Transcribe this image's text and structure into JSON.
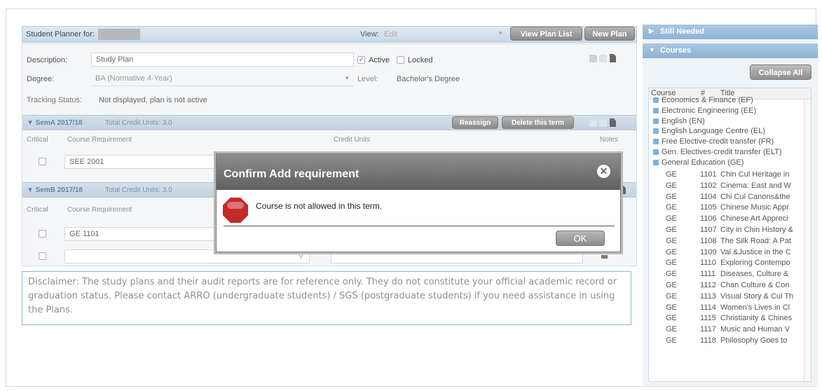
{
  "planner": {
    "title": "Student Planner for:",
    "view_label": "View:",
    "view_value": "Edit",
    "view_plan_list": "View Plan List",
    "new_plan": "New Plan"
  },
  "form": {
    "description_label": "Description:",
    "description_value": "Study Plan",
    "active_label": "Active",
    "locked_label": "Locked",
    "degree_label": "Degree:",
    "degree_value": "BA (Normative 4-Year)",
    "level_label": "Level:",
    "level_value": "Bachelor's Degree",
    "tracking_label": "Tracking Status:",
    "tracking_value": "Not displayed, plan is not active"
  },
  "terms": [
    {
      "name": "SemA 2017/18",
      "credits": "Total Credit Units: 3.0",
      "reassign": "Reassign",
      "delete": "Delete this term",
      "course": "SEE 2001"
    },
    {
      "name": "SemB 2017/18",
      "credits": "Total Credit Units: 3.0",
      "course": "GE 1101"
    }
  ],
  "columns": {
    "critical": "Critical",
    "requirement": "Course Requirement",
    "credit_units": "Credit Units",
    "notes": "Notes"
  },
  "disclaimer": "Disclaimer: The study plans and their audit reports are for reference only. They do not constitute your official academic record or graduation status. Please contact ARRO (undergraduate students) / SGS (postgraduate students) if you need assistance in using the Plans.",
  "right_panel": {
    "still_needed": "Still Needed",
    "courses": "Courses",
    "collapse_all": "Collapse All",
    "col_course": "Course",
    "col_num": "#",
    "col_title": "Title",
    "groups": [
      "Economics & Finance (EF)",
      "Electronic Engineering (EE)",
      "English (EN)",
      "English Language Centre (EL)",
      "Free Elective-credit transfer (FR)",
      "Gen. Electives-credit transfer (ELT)",
      "General Education (GE)"
    ],
    "ge_courses": [
      {
        "code": "GE",
        "num": "1101",
        "title": "Chin Cul Heritage in"
      },
      {
        "code": "GE",
        "num": "1102",
        "title": "Cinema: East and W"
      },
      {
        "code": "GE",
        "num": "1104",
        "title": "Chi Cul Canons&the"
      },
      {
        "code": "GE",
        "num": "1105",
        "title": "Chinese Music Appr"
      },
      {
        "code": "GE",
        "num": "1106",
        "title": "Chinese Art Appreci"
      },
      {
        "code": "GE",
        "num": "1107",
        "title": "City in Chin History &"
      },
      {
        "code": "GE",
        "num": "1108",
        "title": "The Silk Road: A Pat"
      },
      {
        "code": "GE",
        "num": "1109",
        "title": "Val &Justice in the C"
      },
      {
        "code": "GE",
        "num": "1110",
        "title": "Exploring Contempo"
      },
      {
        "code": "GE",
        "num": "1111",
        "title": "Diseases, Culture &"
      },
      {
        "code": "GE",
        "num": "1112",
        "title": "Chan Culture & Con"
      },
      {
        "code": "GE",
        "num": "1113",
        "title": "Visual Story & Cul Th"
      },
      {
        "code": "GE",
        "num": "1114",
        "title": "Women's Lives in Cl"
      },
      {
        "code": "GE",
        "num": "1115",
        "title": "Christianity & Chines"
      },
      {
        "code": "GE",
        "num": "1117",
        "title": "Music and Human V"
      },
      {
        "code": "GE",
        "num": "1118",
        "title": "Philosophy Goes to"
      }
    ]
  },
  "modal": {
    "title": "Confirm Add requirement",
    "message": "Course is not allowed in this term.",
    "ok": "OK",
    "close_glyph": "✕"
  }
}
